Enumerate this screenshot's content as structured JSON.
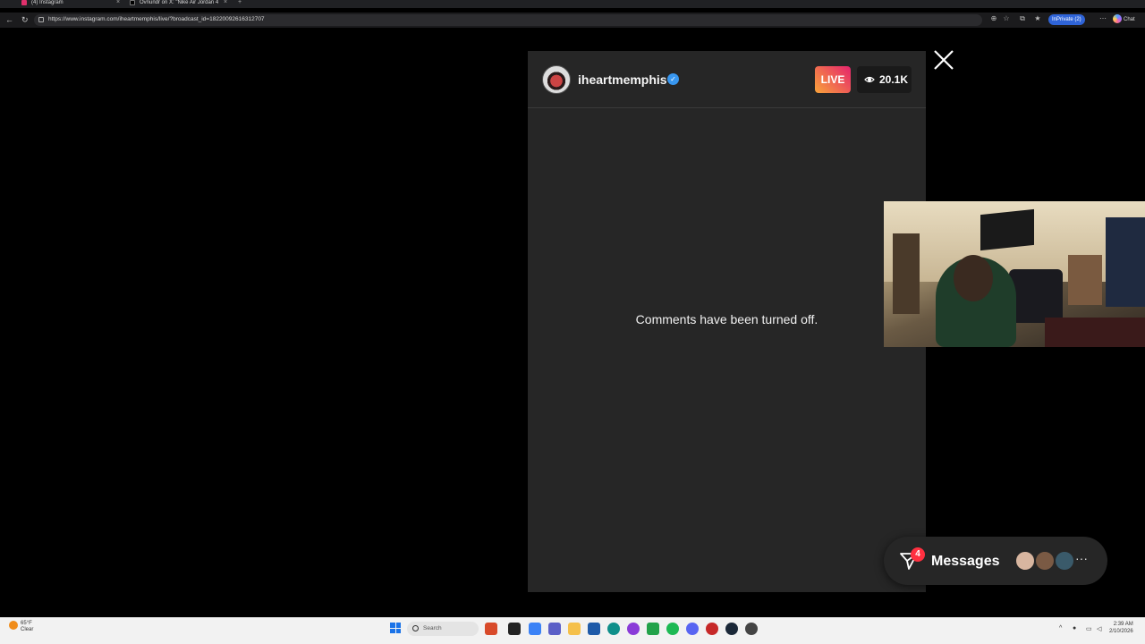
{
  "browser": {
    "tabs": [
      {
        "title": "(4) Instagram"
      },
      {
        "title": "Ovnundr on X: \"Nike Air Jordan 4"
      }
    ],
    "url": "https://www.instagram.com/iheartmemphis/live/?broadcast_id=18220092616312707",
    "inprivate_label": "InPrivate (2)",
    "chat_label": "Chat"
  },
  "live": {
    "username": "iheartmemphis",
    "live_label": "LIVE",
    "viewer_count": "20.1K",
    "comments_notice": "Comments have been turned off."
  },
  "messages": {
    "label": "Messages",
    "unread_count": "4",
    "more_label": "···"
  },
  "taskbar": {
    "weather_temp": "65°F",
    "weather_desc": "Clear",
    "search_placeholder": "Search",
    "time": "2:39 AM",
    "date": "2/10/2026"
  },
  "colors": {
    "panel_bg": "#262626",
    "live_gradient_start": "#f9a43a",
    "live_gradient_end": "#e5236d",
    "verified": "#3897f0",
    "badge": "#ff3040"
  }
}
